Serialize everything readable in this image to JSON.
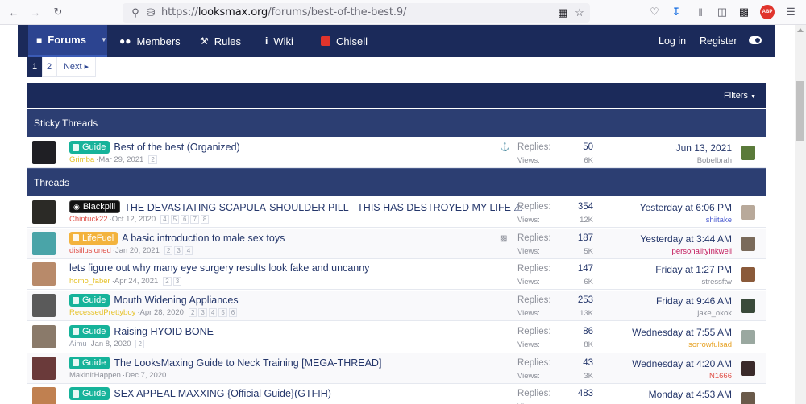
{
  "browser": {
    "url_prefix": "https://",
    "url_domain": "looksmax.org",
    "url_path": "/forums/best-of-the-best.9/",
    "icons": [
      "back-icon",
      "forward-icon",
      "reload-icon",
      "shield-icon",
      "lock-icon",
      "qr-icon",
      "star-icon",
      "pocket-icon",
      "download-icon",
      "library-icon",
      "sidebar-icon",
      "extensions-icon",
      "adblock-icon",
      "menu-icon"
    ],
    "adblock_label": "ABP"
  },
  "forum_nav": {
    "tabs": [
      {
        "label": "Forums",
        "icon": "chat-icon"
      },
      {
        "label": "Members",
        "icon": "users-icon"
      },
      {
        "label": "Rules",
        "icon": "gavel-icon"
      },
      {
        "label": "Wiki",
        "icon": "info-icon"
      },
      {
        "label": "Chisell",
        "icon": "chisell-icon"
      }
    ],
    "login": "Log in",
    "register": "Register"
  },
  "pagination": {
    "pages": [
      "1",
      "2"
    ],
    "next": "Next"
  },
  "filters_label": "Filters",
  "sticky_heading": "Sticky Threads",
  "threads_heading": "Threads",
  "stat_labels": {
    "replies": "Replies:",
    "views": "Views:"
  },
  "sticky": [
    {
      "label": "Guide",
      "label_type": "guide",
      "title": "Best of the best (Organized)",
      "author": "Grimba",
      "author_color": "#e6c229",
      "date": "Mar 29, 2021",
      "pages": [
        "2"
      ],
      "icon": "pin-icon",
      "replies": "50",
      "views": "6K",
      "last_date": "Jun 13, 2021",
      "last_user": "Bobelbrah",
      "last_user_color": "#8c8f99",
      "avatar_color": "#1f1f24",
      "last_avatar_color": "#5a7a3a"
    }
  ],
  "threads": [
    {
      "label": "Blackpill",
      "label_type": "blackpill",
      "title": "THE DEVASTATING SCAPULA-SHOULDER PILL - THIS HAS DESTROYED MY LIFE ⚠",
      "author": "Chintuck22",
      "author_color": "#e0524a",
      "date": "Oct 12, 2020",
      "pages": [
        "4",
        "5",
        "6",
        "7",
        "8"
      ],
      "icon": "",
      "replies": "354",
      "views": "12K",
      "last_date": "Yesterday at 6:06 PM",
      "last_user": "shiitake",
      "last_user_color": "#4a5bd0",
      "avatar_color": "#2b2a26",
      "last_avatar_color": "#b8a99a"
    },
    {
      "label": "LifeFuel",
      "label_type": "lifefuel",
      "title": "A basic introduction to male sex toys",
      "author": "disillusioned",
      "author_color": "#e0524a",
      "date": "Jan 20, 2021",
      "pages": [
        "2",
        "3",
        "4"
      ],
      "icon": "chart-icon",
      "replies": "187",
      "views": "5K",
      "last_date": "Yesterday at 3:44 AM",
      "last_user": "personalityinkwell",
      "last_user_color": "#c2185b",
      "avatar_color": "#4aa4a8",
      "last_avatar_color": "#7a6a5a"
    },
    {
      "label": "",
      "label_type": "",
      "title": "lets figure out why many eye surgery results look fake and uncanny",
      "author": "homo_faber",
      "author_color": "#e6c229",
      "date": "Apr 24, 2021",
      "pages": [
        "2",
        "3"
      ],
      "icon": "",
      "replies": "147",
      "views": "6K",
      "last_date": "Friday at 1:27 PM",
      "last_user": "stressftw",
      "last_user_color": "#8c8f99",
      "avatar_color": "#b88a6a",
      "last_avatar_color": "#8a5a3a"
    },
    {
      "label": "Guide",
      "label_type": "guide",
      "title": "Mouth Widening Appliances",
      "author": "RecessedPrettyboy",
      "author_color": "#e6c229",
      "date": "Apr 28, 2020",
      "pages": [
        "2",
        "3",
        "4",
        "5",
        "6"
      ],
      "icon": "",
      "replies": "253",
      "views": "13K",
      "last_date": "Friday at 9:46 AM",
      "last_user": "jake_okok",
      "last_user_color": "#8c8f99",
      "avatar_color": "#5a5a5a",
      "last_avatar_color": "#3a4a3a"
    },
    {
      "label": "Guide",
      "label_type": "guide",
      "title": "Raising HYOID BONE",
      "author": "Aimu",
      "author_color": "#9aa0ad",
      "date": "Jan 8, 2020",
      "pages": [
        "2"
      ],
      "icon": "",
      "replies": "86",
      "views": "8K",
      "last_date": "Wednesday at 7:55 AM",
      "last_user": "sorrowfulsad",
      "last_user_color": "#e6a020",
      "avatar_color": "#8a7a6a",
      "last_avatar_color": "#9aa8a0"
    },
    {
      "label": "Guide",
      "label_type": "guide",
      "title": "The LooksMaxing Guide to Neck Training [MEGA-THREAD]",
      "author": "MakinItHappen",
      "author_color": "#8c8f99",
      "date": "Dec 7, 2020",
      "pages": [],
      "icon": "",
      "replies": "43",
      "views": "3K",
      "last_date": "Wednesday at 4:20 AM",
      "last_user": "N1666",
      "last_user_color": "#e0524a",
      "avatar_color": "#6a3a3a",
      "last_avatar_color": "#3a2a2a"
    },
    {
      "label": "Guide",
      "label_type": "guide",
      "title": "SEX APPEAL MAXXING {Official Guide}(GTFIH)",
      "author": "",
      "author_color": "#8c8f99",
      "date": "",
      "pages": [],
      "icon": "",
      "replies": "483",
      "views": "",
      "last_date": "Monday at 4:53 AM",
      "last_user": "",
      "last_user_color": "#8c8f99",
      "avatar_color": "#c08050",
      "last_avatar_color": "#6a5a4a"
    }
  ]
}
